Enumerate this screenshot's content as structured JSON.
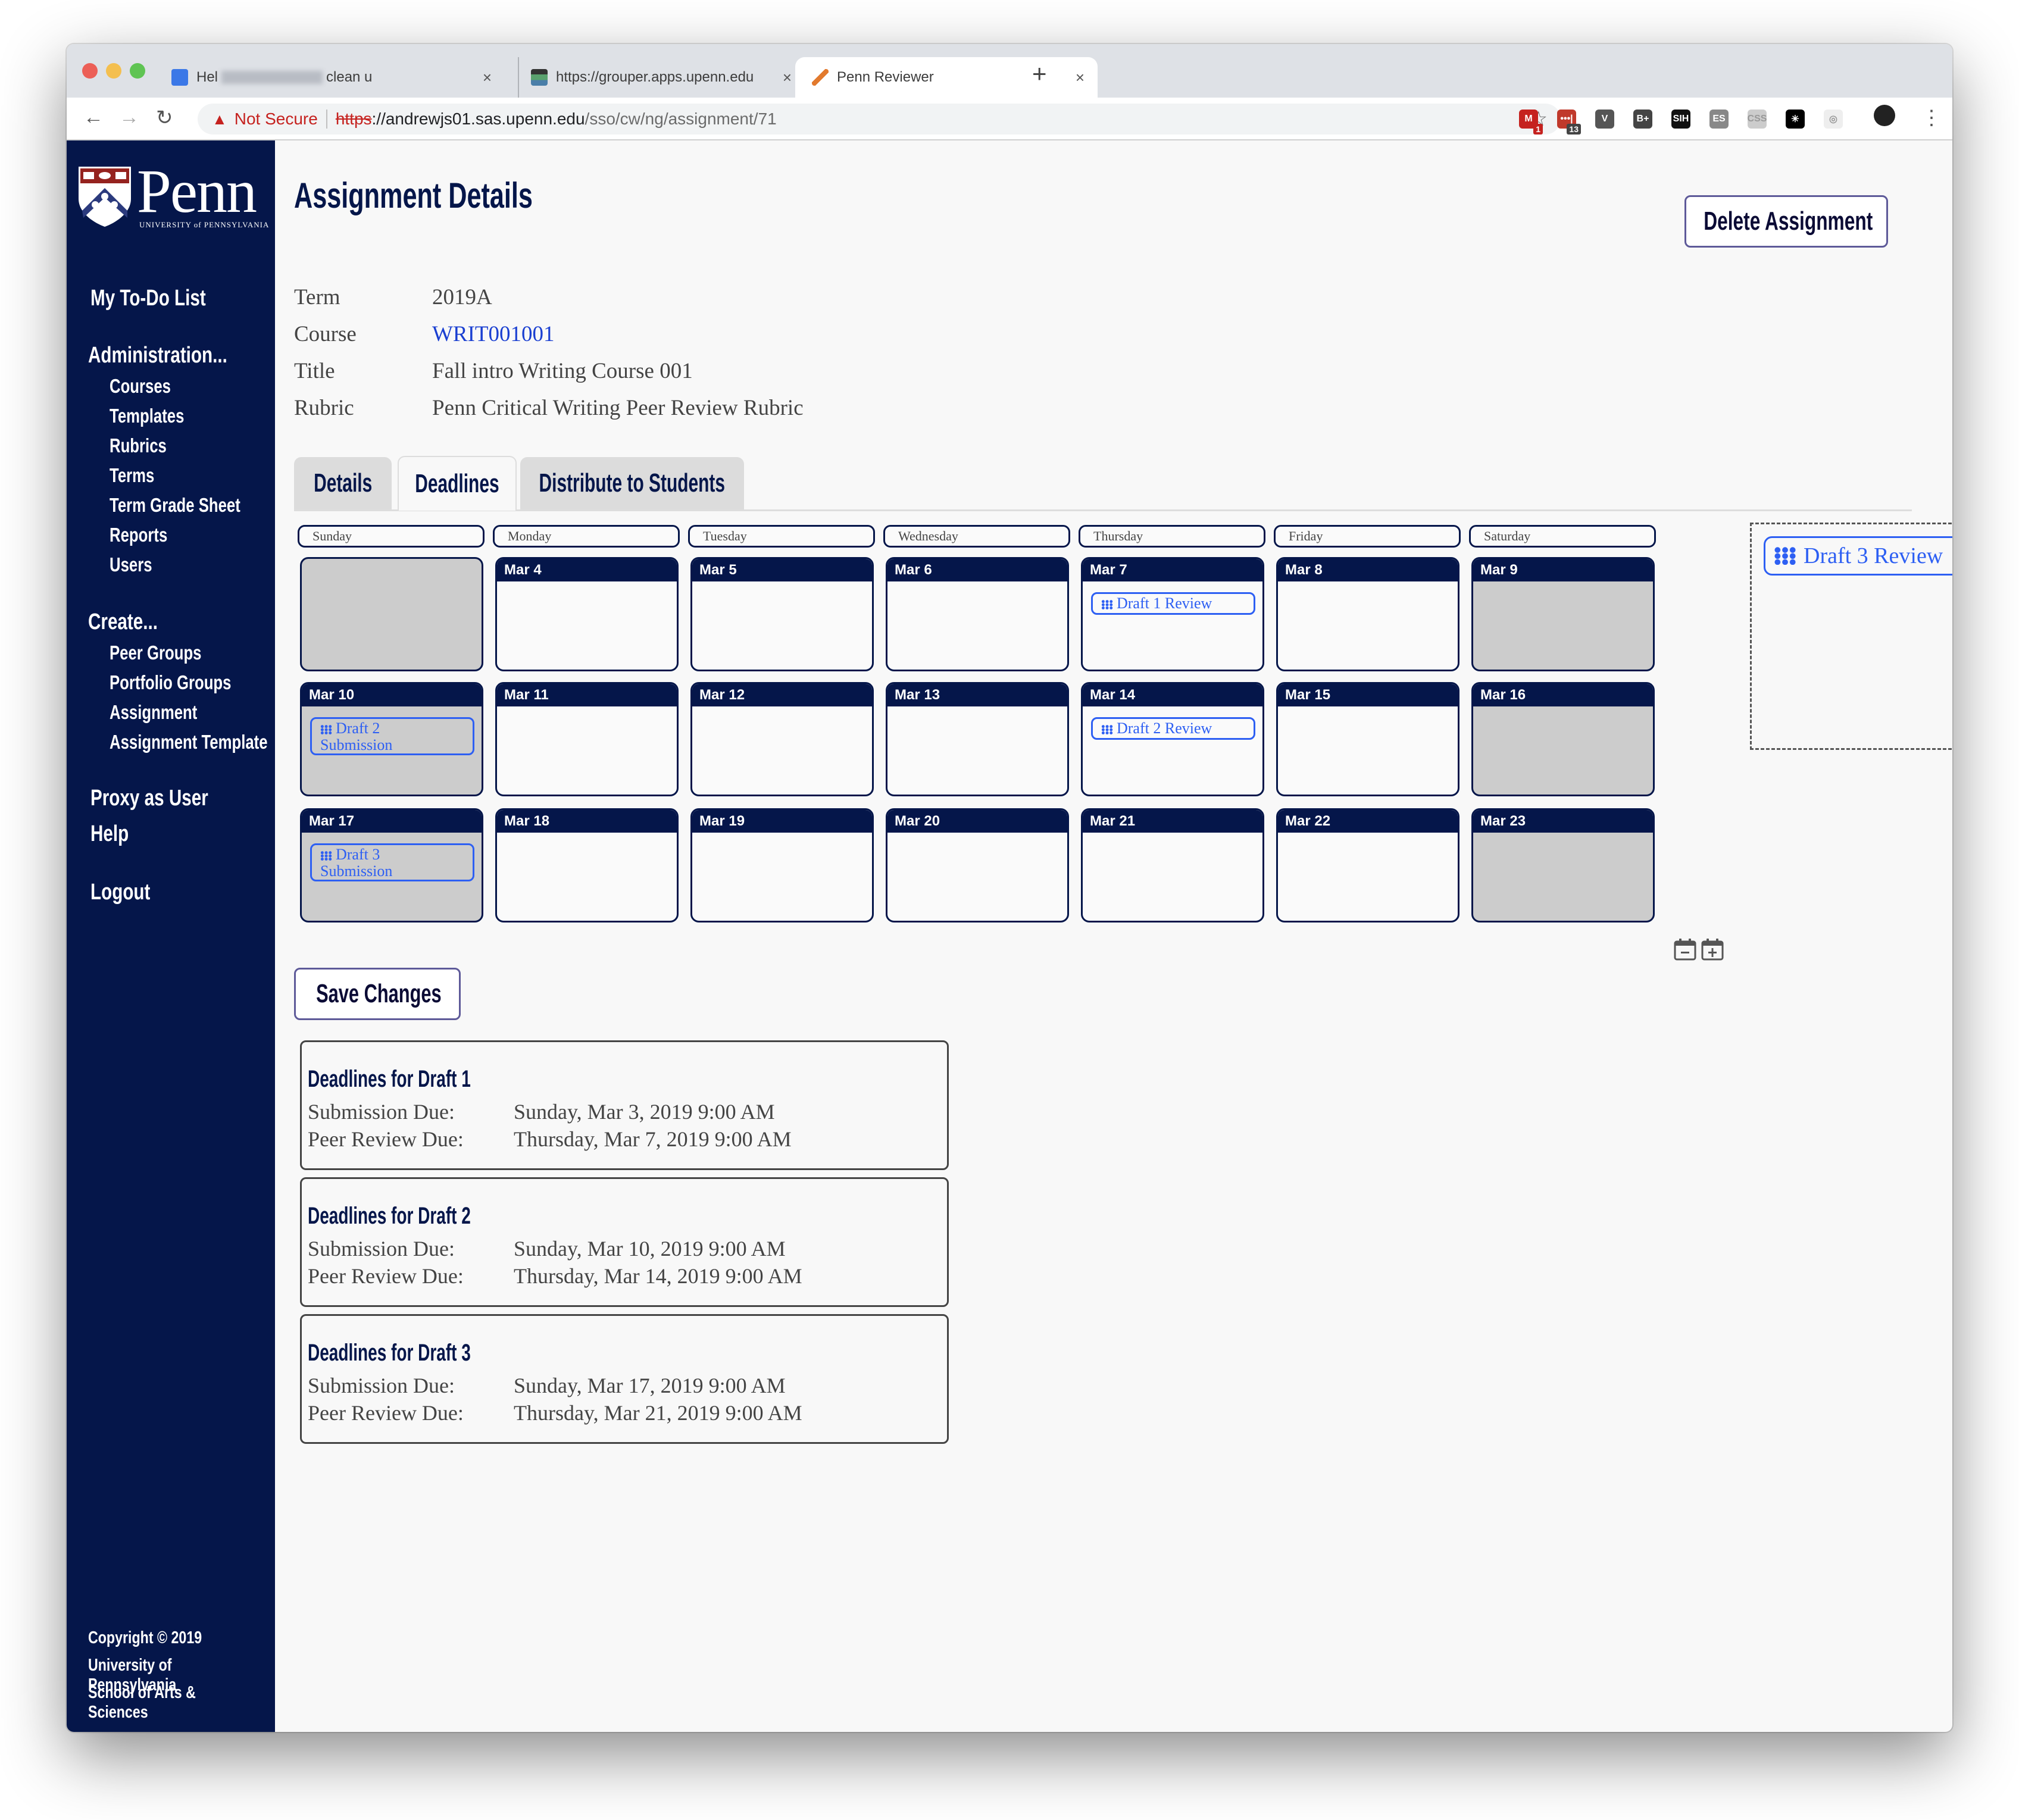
{
  "browser": {
    "tabs": [
      {
        "title_prefix": "Hel",
        "title_suffix": "clean u",
        "close": "×"
      },
      {
        "title": "https://grouper.apps.upenn.edu",
        "close": "×"
      },
      {
        "title": "Penn Reviewer",
        "close": "×",
        "active": true
      }
    ],
    "new_tab": "+",
    "nav": {
      "back": "←",
      "forward": "→",
      "reload": "↻"
    },
    "security_warning_icon": "▲",
    "security_label": "Not Secure",
    "url_protocol": "https",
    "url_host": "://andrewjs01.sas.upenn.edu",
    "url_path": "/sso/cw/ng/assignment/71",
    "bookmark_icon": "☆",
    "extensions": [
      {
        "name": "gmail",
        "label": "M",
        "badge": "1",
        "color": "#c5221f"
      },
      {
        "name": "lastpass",
        "label": "•••|",
        "badge": "13",
        "color": "#c0392b"
      },
      {
        "name": "pocket",
        "label": "V",
        "color": "#555555"
      },
      {
        "name": "bplus",
        "label": "B+",
        "color": "#444444"
      },
      {
        "name": "sih",
        "label": "SIH",
        "color": "#111111"
      },
      {
        "name": "es",
        "label": "ES",
        "color": "#888888"
      },
      {
        "name": "css",
        "label": "CSS",
        "color": "#cccccc"
      },
      {
        "name": "spark",
        "label": "✳",
        "color": "#000000"
      },
      {
        "name": "circle",
        "label": "◎",
        "color": "#eeeeee"
      }
    ],
    "menu_icon": "⋮"
  },
  "sidebar": {
    "logo_word": "Penn",
    "logo_sub": "UNIVERSITY of PENNSYLVANIA",
    "todo": "My To-Do List",
    "admin_header": "Administration...",
    "admin_items": [
      "Courses",
      "Templates",
      "Rubrics",
      "Terms",
      "Term Grade Sheet",
      "Reports",
      "Users"
    ],
    "create_header": "Create...",
    "create_items": [
      "Peer Groups",
      "Portfolio Groups",
      "Assignment",
      "Assignment Template"
    ],
    "proxy": "Proxy as User",
    "help": "Help",
    "logout": "Logout",
    "footer": [
      "Copyright © 2019",
      "University of Pennsylvania",
      "School of Arts & Sciences"
    ]
  },
  "page": {
    "title": "Assignment Details",
    "delete_button": "Delete Assignment",
    "meta": [
      {
        "label": "Term",
        "value": "2019A"
      },
      {
        "label": "Course",
        "value": "WRIT001001",
        "link": true
      },
      {
        "label": "Title",
        "value": "Fall intro Writing Course 001"
      },
      {
        "label": "Rubric",
        "value": "Penn Critical Writing Peer Review Rubric"
      }
    ],
    "tabs": [
      {
        "label": "Details"
      },
      {
        "label": "Deadlines",
        "active": true
      },
      {
        "label": "Distribute to Students"
      }
    ]
  },
  "calendar": {
    "weekdays": [
      "Sunday",
      "Monday",
      "Tuesday",
      "Wednesday",
      "Thursday",
      "Friday",
      "Saturday"
    ],
    "weeks": [
      [
        {
          "date": "",
          "weekend": true
        },
        {
          "date": "Mar 4"
        },
        {
          "date": "Mar 5"
        },
        {
          "date": "Mar 6"
        },
        {
          "date": "Mar 7",
          "event": "Draft 1 Review"
        },
        {
          "date": "Mar 8"
        },
        {
          "date": "Mar 9",
          "weekend": true
        }
      ],
      [
        {
          "date": "Mar 10",
          "weekend": true,
          "event": "Draft 2 Submission"
        },
        {
          "date": "Mar 11"
        },
        {
          "date": "Mar 12"
        },
        {
          "date": "Mar 13"
        },
        {
          "date": "Mar 14",
          "event": "Draft 2 Review"
        },
        {
          "date": "Mar 15"
        },
        {
          "date": "Mar 16",
          "weekend": true
        }
      ],
      [
        {
          "date": "Mar 17",
          "weekend": true,
          "event": "Draft 3 Submission"
        },
        {
          "date": "Mar 18"
        },
        {
          "date": "Mar 19"
        },
        {
          "date": "Mar 20"
        },
        {
          "date": "Mar 21"
        },
        {
          "date": "Mar 22"
        },
        {
          "date": "Mar 23",
          "weekend": true
        }
      ]
    ],
    "unassigned_event": "Draft 3 Review",
    "remove_week_icon": "calendar-minus",
    "add_week_icon": "calendar-plus"
  },
  "save_button": "Save Changes",
  "deadlines": [
    {
      "title": "Deadlines for Draft 1",
      "submission_label": "Submission Due:",
      "submission": "Sunday, Mar 3, 2019 9:00 AM",
      "review_label": "Peer Review Due:",
      "review": "Thursday, Mar 7, 2019 9:00 AM"
    },
    {
      "title": "Deadlines for Draft 2",
      "submission_label": "Submission Due:",
      "submission": "Sunday, Mar 10, 2019 9:00 AM",
      "review_label": "Peer Review Due:",
      "review": "Thursday, Mar 14, 2019 9:00 AM"
    },
    {
      "title": "Deadlines for Draft 3",
      "submission_label": "Submission Due:",
      "submission": "Sunday, Mar 17, 2019 9:00 AM",
      "review_label": "Peer Review Due:",
      "review": "Thursday, Mar 21, 2019 9:00 AM"
    }
  ],
  "colors": {
    "navy": "#05164a",
    "event_blue": "#2d5ff3",
    "weekend_gray": "#cccccc",
    "link_blue": "#1a3fd1"
  }
}
